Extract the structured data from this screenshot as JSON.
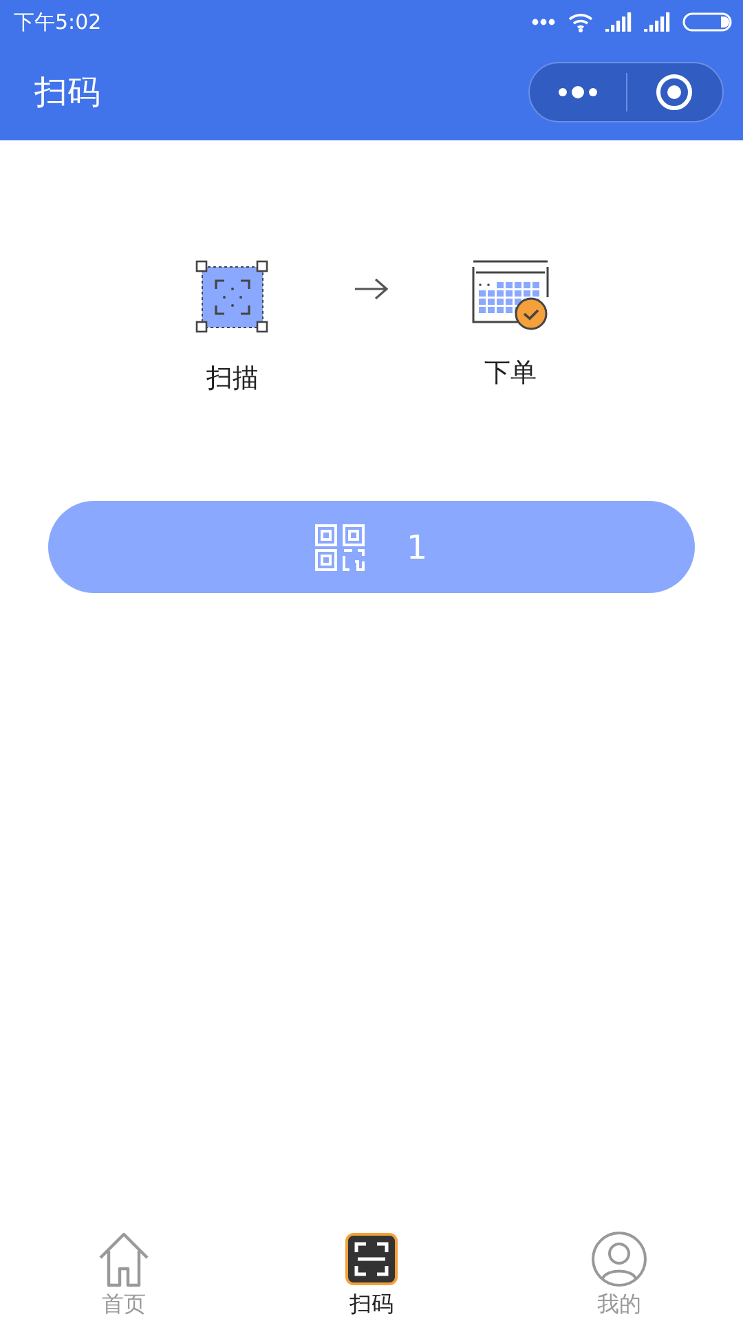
{
  "status_bar": {
    "time": "下午5:02"
  },
  "nav_bar": {
    "title": "扫码"
  },
  "steps": [
    {
      "kind": "scan",
      "label": "扫描"
    },
    {
      "kind": "order",
      "label": "下单"
    }
  ],
  "scan_button": {
    "label": "1"
  },
  "tab_bar": [
    {
      "kind": "home",
      "label": "首页",
      "selected": false
    },
    {
      "kind": "scan",
      "label": "扫码",
      "selected": true
    },
    {
      "kind": "profile",
      "label": "我的",
      "selected": false
    }
  ]
}
